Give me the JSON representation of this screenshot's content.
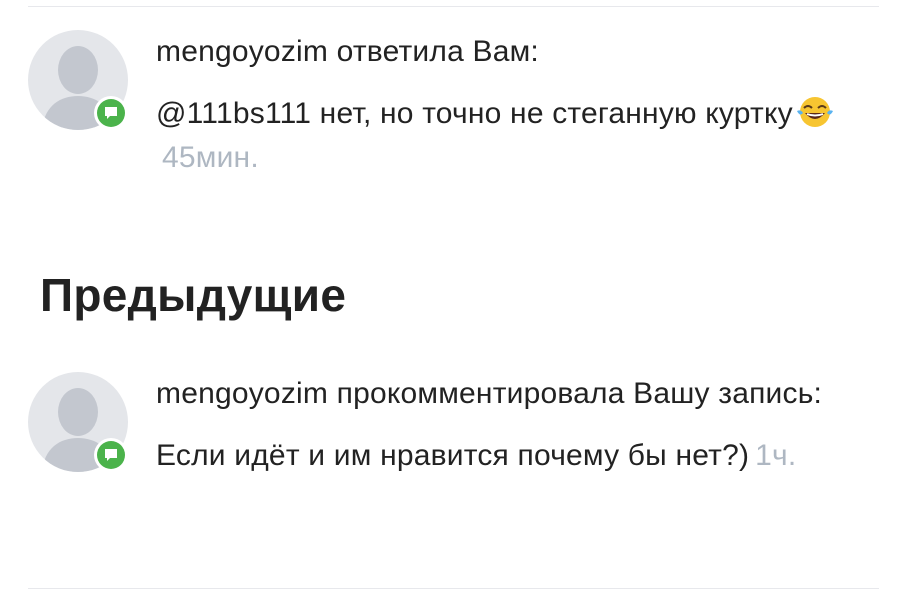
{
  "notifications": [
    {
      "author": "mengoyozim",
      "action": "ответила Вам:",
      "text": "@111bs111 нет, но точно не стеганную куртку",
      "emoji": "face-with-tears-of-joy",
      "time": "45мин.",
      "badge_icon": "comment-icon"
    },
    {
      "author": "mengoyozim",
      "action": "прокомментировала Вашу запись:",
      "text": "Если идёт и им нравится почему бы нет?)",
      "time": "1ч.",
      "badge_icon": "comment-icon"
    }
  ],
  "sections": {
    "previous_title": "Предыдущие"
  },
  "colors": {
    "badge": "#4bb34b",
    "time": "#aeb7c2",
    "avatar_bg": "#e4e6ea",
    "avatar_fg": "#c3c7cf",
    "divider": "#e7e8ec"
  }
}
